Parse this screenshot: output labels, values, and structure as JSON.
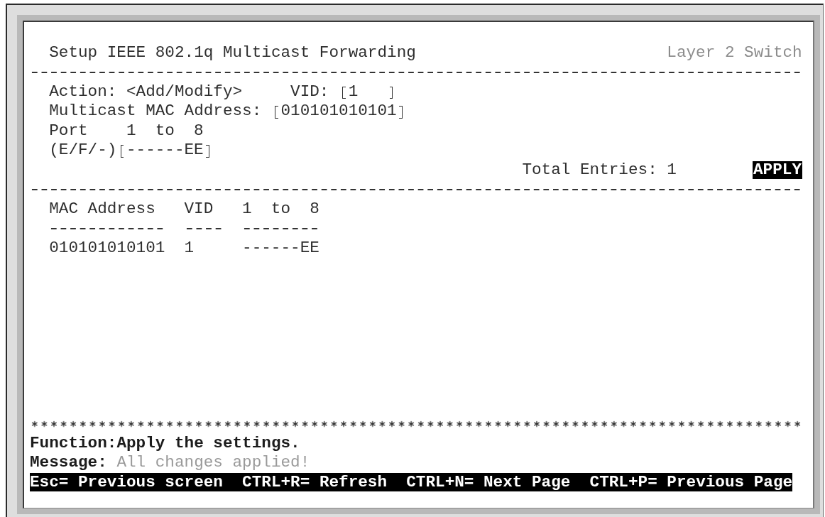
{
  "screen": {
    "title": "Setup IEEE 802.1q Multicast Forwarding",
    "device": "Layer 2 Switch"
  },
  "form": {
    "action": {
      "label": "Action:",
      "value": "<Add/Modify>"
    },
    "vid": {
      "label": "VID:",
      "value": "1"
    },
    "mac_address": {
      "label": "Multicast MAC Address:",
      "value": "010101010101"
    },
    "ports": {
      "label": "Port",
      "range": "1  to  8"
    },
    "port_states": {
      "label": "(E/F/-)",
      "value": "------EE"
    },
    "total_entries": {
      "label": "Total Entries:",
      "value": "1"
    },
    "apply_button": {
      "label": "APPLY",
      "focused": true
    }
  },
  "table": {
    "columns": [
      "MAC Address",
      "VID",
      "1  to  8"
    ],
    "rows": [
      [
        "010101010101",
        "1",
        "------EE"
      ]
    ]
  },
  "function": {
    "label": "Function:",
    "text": "Apply the settings."
  },
  "message": {
    "label": "Message:",
    "text": "All changes applied!"
  },
  "status_bar": [
    "Esc= Previous screen",
    "CTRL+R= Refresh",
    "CTRL+N= Next Page",
    "CTRL+P= Previous Page"
  ]
}
